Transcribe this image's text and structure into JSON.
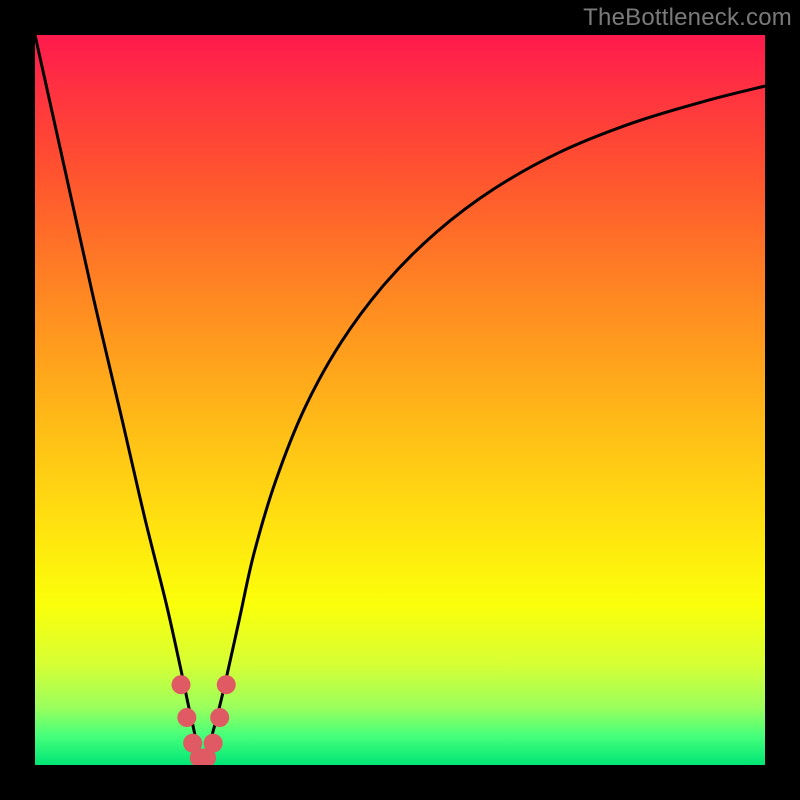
{
  "watermark": "TheBottleneck.com",
  "chart_data": {
    "type": "line",
    "title": "",
    "xlabel": "",
    "ylabel": "",
    "xlim": [
      0,
      100
    ],
    "ylim": [
      0,
      100
    ],
    "optimum_x": 23,
    "series": [
      {
        "name": "bottleneck-curve",
        "x": [
          0,
          4,
          8,
          12,
          15,
          18,
          20,
          21.5,
          23,
          24.5,
          26,
          28,
          30,
          33,
          37,
          42,
          48,
          55,
          63,
          72,
          82,
          92,
          100
        ],
        "values": [
          100,
          82,
          64,
          47,
          34,
          22,
          13,
          6,
          0.5,
          5,
          11,
          20,
          29,
          39,
          49,
          58,
          66,
          73,
          79,
          84,
          88,
          91,
          93
        ]
      }
    ],
    "markers": [
      {
        "x": 20.0,
        "y": 11.0
      },
      {
        "x": 20.8,
        "y": 6.5
      },
      {
        "x": 21.6,
        "y": 3.0
      },
      {
        "x": 22.5,
        "y": 1.0
      },
      {
        "x": 23.5,
        "y": 1.0
      },
      {
        "x": 24.4,
        "y": 3.0
      },
      {
        "x": 25.3,
        "y": 6.5
      },
      {
        "x": 26.2,
        "y": 11.0
      }
    ],
    "colors": {
      "curve": "#000000",
      "marker": "#e05a63"
    }
  }
}
